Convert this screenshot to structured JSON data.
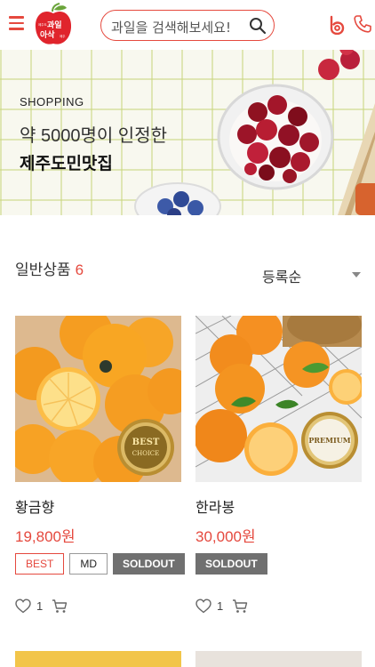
{
  "header": {
    "search_placeholder": "과일을 검색해보세요!",
    "logo_small_left": "제주도",
    "logo_main": "과일",
    "logo_main2": "아삭",
    "logo_small_right": "제주"
  },
  "banner": {
    "label": "SHOPPING",
    "subtitle": "약 5000명이 인정한",
    "title": "제주도민맛집"
  },
  "list": {
    "heading": "일반상품",
    "count": "6",
    "sort_selected": "등록순"
  },
  "products": [
    {
      "name": "황금향",
      "price": "19,800원",
      "tags": [
        "BEST",
        "MD",
        "SOLDOUT"
      ],
      "likes": "1",
      "seal_line1": "BEST",
      "seal_line2": "CHOICE"
    },
    {
      "name": "한라봉",
      "price": "30,000원",
      "tags": [
        "SOLDOUT"
      ],
      "likes": "1",
      "seal_line1": "PREMIUM",
      "seal_line2": ""
    }
  ],
  "colors": {
    "accent": "#e5493e",
    "soldout_bg": "#707070",
    "banner_grid": "#cad682"
  }
}
